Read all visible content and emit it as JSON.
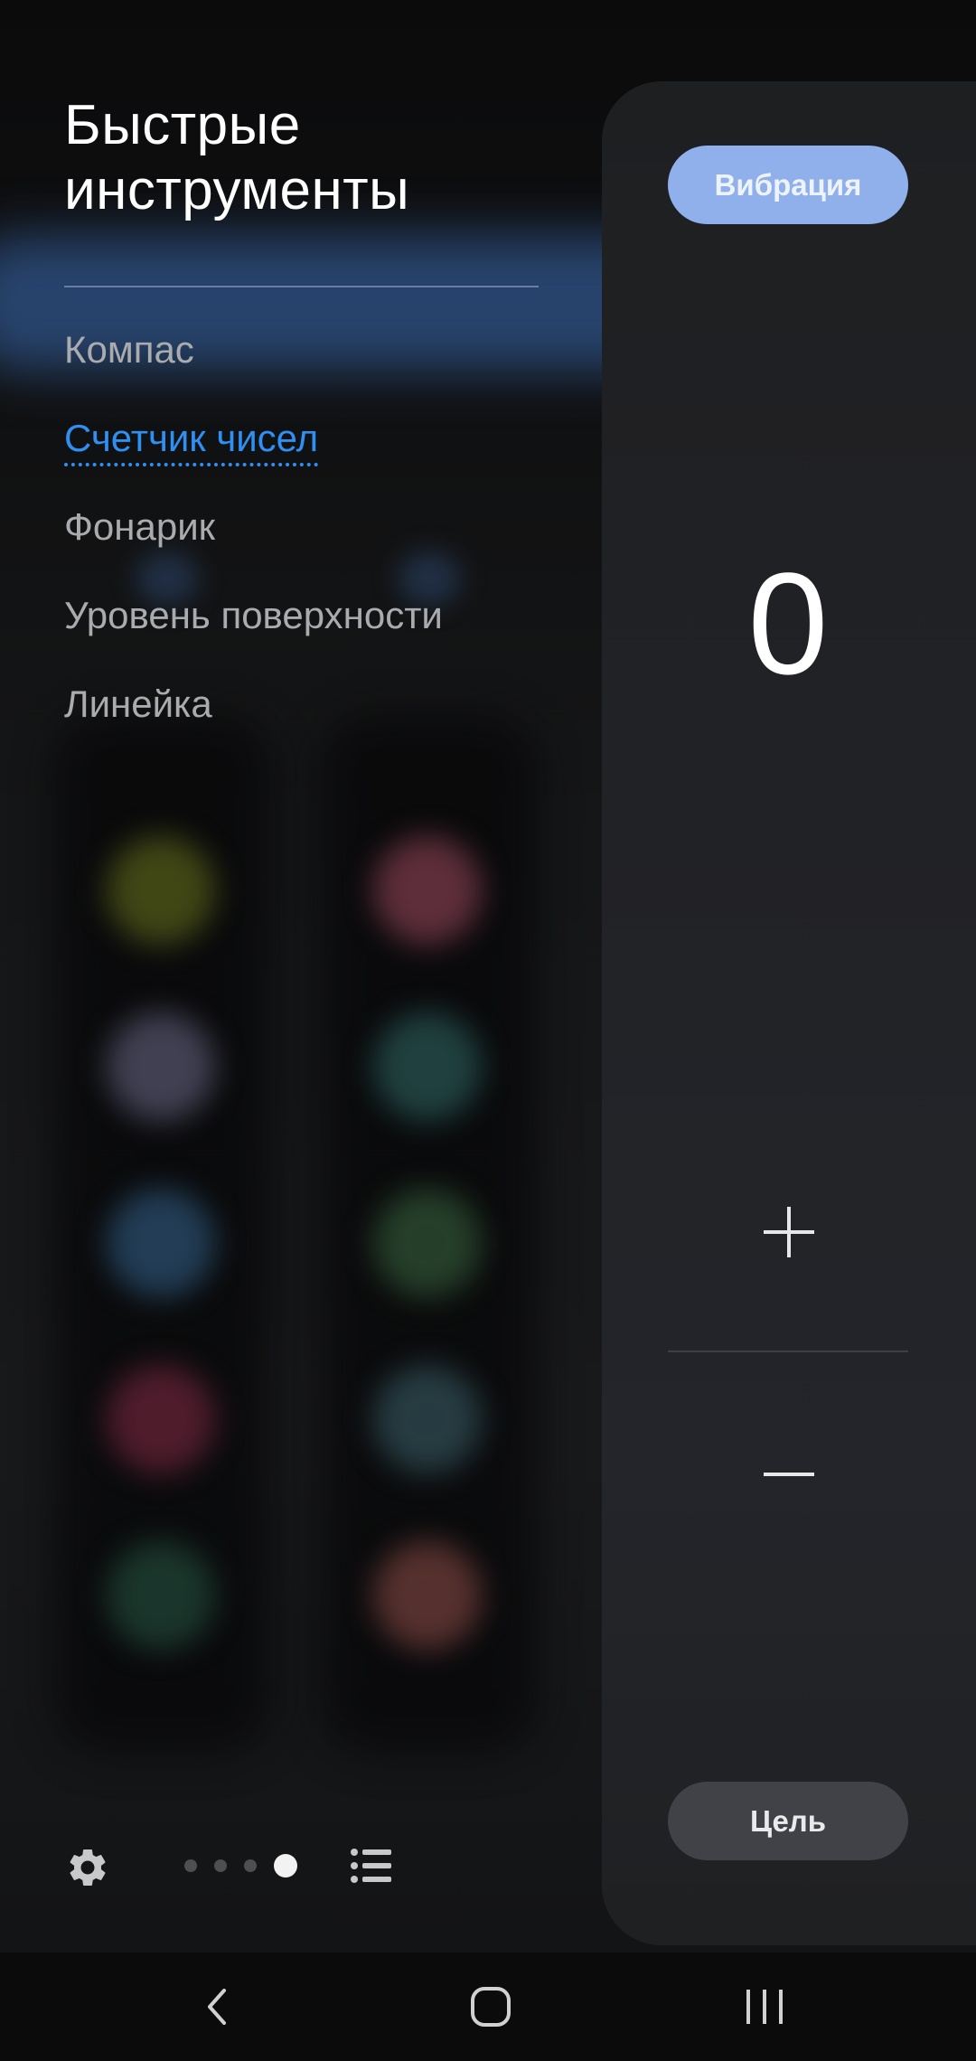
{
  "panel": {
    "title_line1": "Быстрые",
    "title_line2": "инструменты"
  },
  "tools": [
    {
      "label": "Компас",
      "active": false
    },
    {
      "label": "Счетчик чисел",
      "active": true
    },
    {
      "label": "Фонарик",
      "active": false
    },
    {
      "label": "Уровень поверхности",
      "active": false
    },
    {
      "label": "Линейка",
      "active": false
    }
  ],
  "counter": {
    "vibration_label": "Вибрация",
    "value": "0",
    "increment_icon": "plus-icon",
    "decrement_icon": "minus-icon",
    "target_label": "Цель"
  },
  "bottom_bar": {
    "settings_icon": "gear-icon",
    "list_icon": "list-icon",
    "page_count": 4,
    "current_page": 4
  },
  "nav": {
    "back_icon": "back-icon",
    "home_icon": "home-icon",
    "recents_icon": "recents-icon"
  },
  "colors": {
    "accent": "#2f8ff2",
    "vibration_button": "#8fb0eb",
    "target_button": "#404247",
    "card": "#222327"
  }
}
